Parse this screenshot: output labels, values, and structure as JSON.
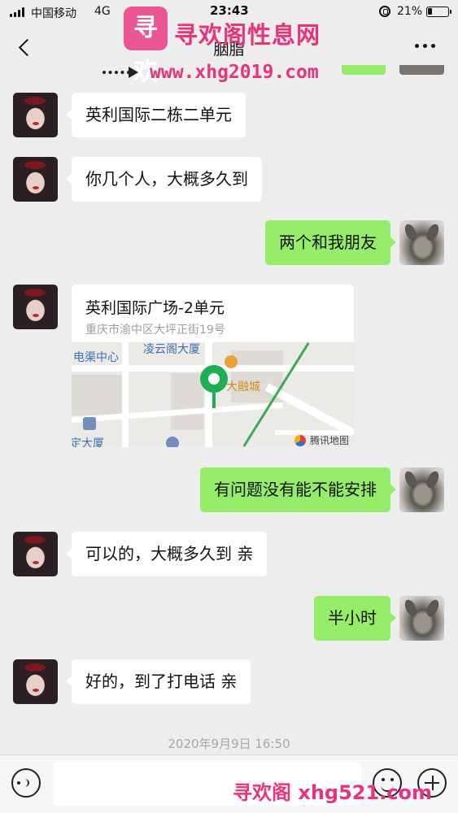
{
  "status_bar": {
    "carrier": "中国移动",
    "network": "4G",
    "time": "23:43",
    "battery": "21%",
    "battery_level": 0.21
  },
  "header": {
    "title": "胭脂"
  },
  "watermark": {
    "logo_text": "寻欢",
    "site_name": "寻欢阁性息网",
    "site_url": "www.xhg2019.com",
    "bottom_text": "寻欢阁 xhg521.com"
  },
  "messages": [
    {
      "side": "left",
      "text": "英利国际二栋二单元"
    },
    {
      "side": "left",
      "text": "你几个人，大概多久到"
    },
    {
      "side": "right",
      "text": "两个和我朋友"
    },
    {
      "side": "left",
      "type": "location",
      "title": "英利国际广场-2单元",
      "address": "重庆市渝中区大坪正街19号",
      "map_labels": [
        "电渠中心",
        "凌云阁大厦",
        "大融城",
        "定大厦"
      ],
      "map_provider": "腾讯地图"
    },
    {
      "side": "right",
      "text": "有问题没有能不能安排"
    },
    {
      "side": "left",
      "text": "可以的，大概多久到 亲"
    },
    {
      "side": "right",
      "text": "半小时"
    },
    {
      "side": "left",
      "text": "好的，到了打电话 亲"
    }
  ],
  "timestamp": "2020年9月9日 16:50",
  "input": {
    "value": "",
    "placeholder": ""
  },
  "colors": {
    "self_bubble": "#95ec69",
    "other_bubble": "#ffffff",
    "background": "#ededed",
    "watermark": "#e8347a"
  },
  "icons": {
    "back": "chevron-left-icon",
    "more": "more-icon",
    "voice": "voice-icon",
    "emoji": "emoji-icon",
    "plus": "plus-icon"
  }
}
